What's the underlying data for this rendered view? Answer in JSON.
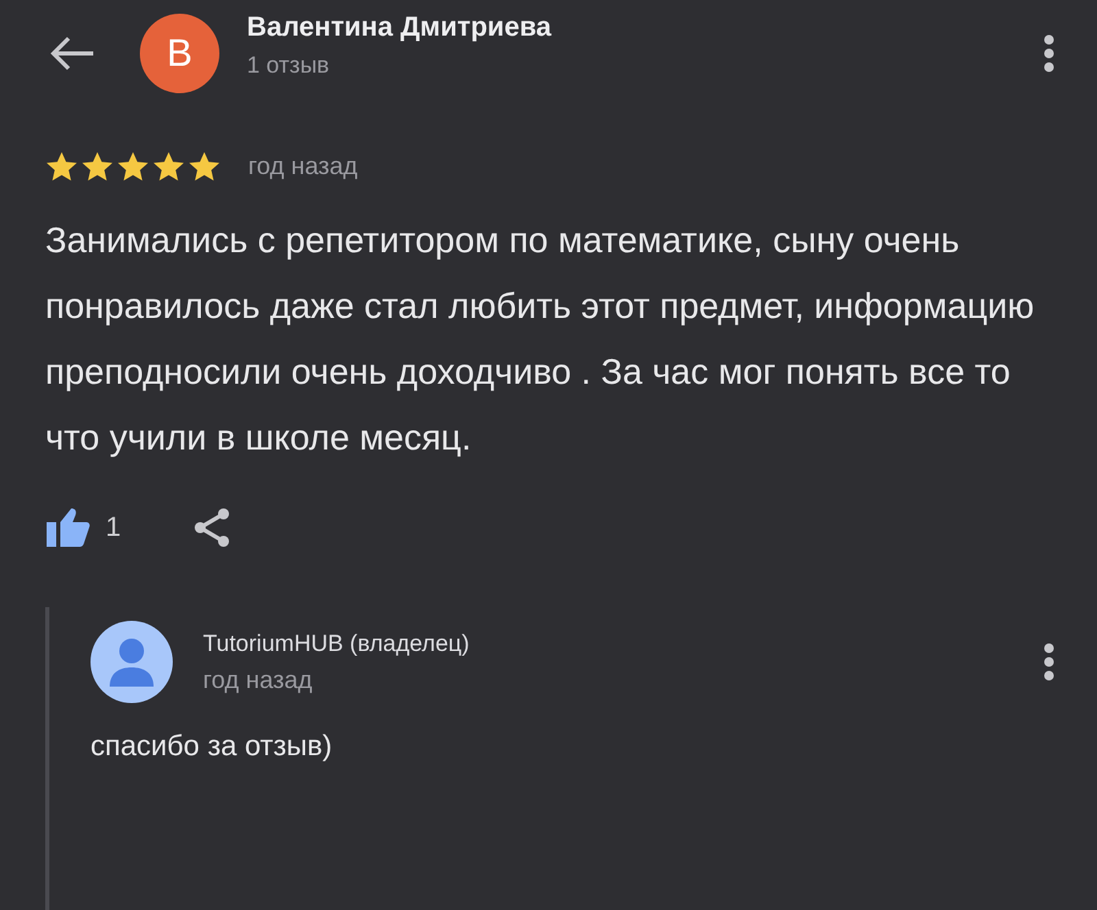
{
  "review": {
    "author": "Валентина Дмитриева",
    "avatar_letter": "B",
    "author_meta": "1 отзыв",
    "stars": 5,
    "time": "год назад",
    "text": "Занимались с репетитором по математике, сыну очень понравилось даже стал любить этот предмет, информацию преподносили очень доходчиво . За час мог понять все то что учили в школе месяц.",
    "likes": "1",
    "liked": true
  },
  "reply": {
    "author": "TutoriumHUB (владелец)",
    "time": "год назад",
    "text": "спасибо за отзыв)"
  }
}
